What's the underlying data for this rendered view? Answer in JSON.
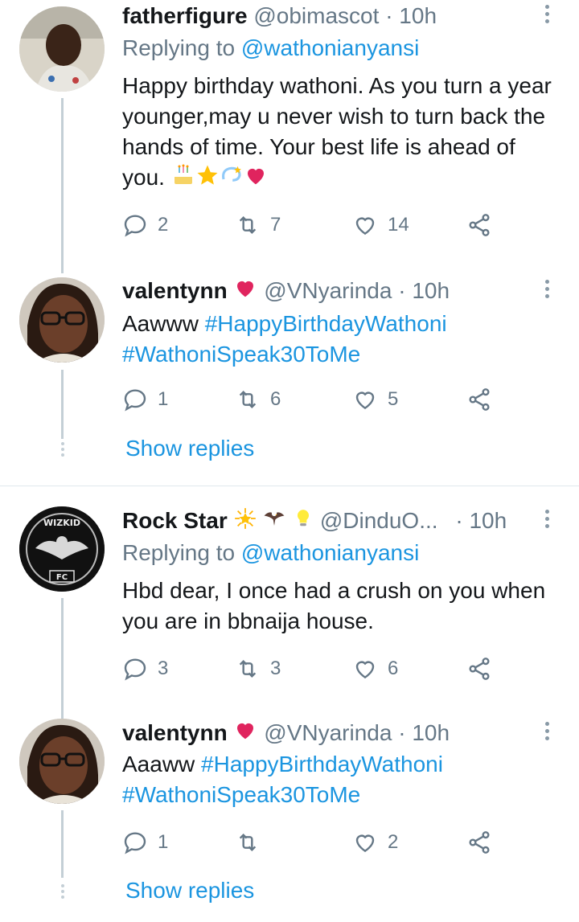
{
  "tweets": [
    {
      "name": "fatherfigure",
      "handle": "@obimascot",
      "sep": "·",
      "time": "10h",
      "reply_prefix": "Replying to",
      "reply_mention": "@wathonianyansi",
      "text": "Happy birthday wathoni. As you turn a year younger,may u never wish to turn back the hands of time. Your best life is ahead of you.",
      "replies": "2",
      "retweets": "7",
      "likes": "14"
    },
    {
      "name": "valentynn",
      "handle": "@VNyarinda",
      "sep": "·",
      "time": "10h",
      "text_prefix": "Aawww",
      "tag1": "#HappyBirthdayWathoni",
      "tag2": "#WathoniSpeak30ToMe",
      "replies": "1",
      "retweets": "6",
      "likes": "5",
      "show_replies": "Show replies"
    },
    {
      "name": "Rock Star",
      "handle": "@DinduO...",
      "sep": "·",
      "time": "10h",
      "reply_prefix": "Replying to",
      "reply_mention": "@wathonianyansi",
      "text": "Hbd dear, I once had a crush on you when you are in bbnaija house.",
      "replies": "3",
      "retweets": "3",
      "likes": "6",
      "avatar_text": "WIZKID",
      "avatar_sub": "FC"
    },
    {
      "name": "valentynn",
      "handle": "@VNyarinda",
      "sep": "·",
      "time": "10h",
      "text_prefix": "Aaaww",
      "tag1": "#HappyBirthdayWathoni",
      "tag2": "#WathoniSpeak30ToMe",
      "replies": "1",
      "retweets": "",
      "likes": "2",
      "show_replies": "Show replies"
    }
  ],
  "colors": {
    "accent": "#1b95e0",
    "muted": "#657786",
    "heart": "#e0245e",
    "thread_line": "#c4cfd6"
  },
  "icons": [
    "reply-icon",
    "retweet-icon",
    "like-icon",
    "share-icon",
    "more-icon"
  ]
}
